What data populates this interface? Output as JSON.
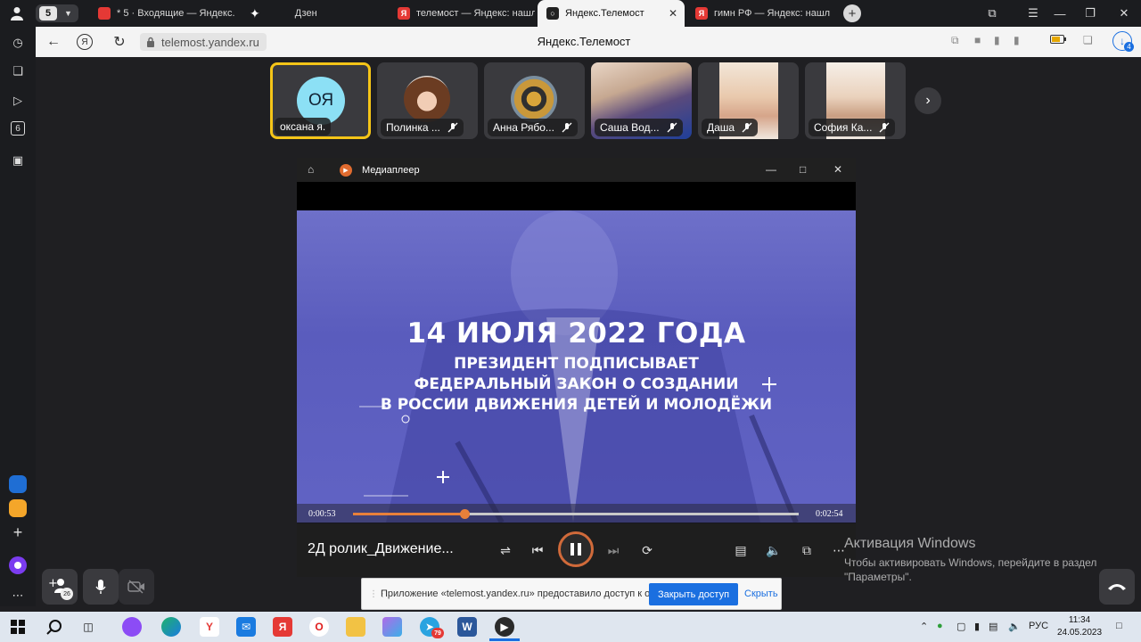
{
  "browser": {
    "tab_count": "5",
    "tabs": [
      {
        "label": "* 5 · Входящие — Яндекс.",
        "fav_color": "#e53935"
      },
      {
        "label": "Дзен",
        "fav_color": "#000000"
      },
      {
        "label": "телемост — Яндекс: нашл",
        "fav_color": "#e53935"
      },
      {
        "label": "Яндекс.Телемост",
        "fav_color": "#222222"
      },
      {
        "label": "гимн РФ — Яндекс: нашл",
        "fav_color": "#e53935"
      }
    ],
    "url": "telemost.yandex.ru",
    "page_title": "Яндекс.Телемост",
    "downloads_badge": "4"
  },
  "participants": [
    {
      "name": "оксана я.",
      "initials": "ОЯ",
      "type": "initials",
      "selected": true
    },
    {
      "name": "Полинка ...",
      "type": "photo",
      "mic_muted": true
    },
    {
      "name": "Анна Рябо...",
      "type": "photo",
      "mic_muted": true
    },
    {
      "name": "Саша Вод...",
      "type": "video",
      "mic_muted": true
    },
    {
      "name": "Даша",
      "type": "video",
      "mic_muted": true
    },
    {
      "name": "София Ка...",
      "type": "video",
      "mic_muted": true
    }
  ],
  "player": {
    "app_title": "Медиаплеер",
    "video_headline": "14 ИЮЛЯ 2022 ГОДА",
    "video_lines": [
      "ПРЕЗИДЕНТ ПОДПИСЫВАЕТ",
      "ФЕДЕРАЛЬНЫЙ ЗАКОН О СОЗДАНИИ",
      "В РОССИИ ДВИЖЕНИЯ ДЕТЕЙ И МОЛОДЁЖИ"
    ],
    "time_current": "0:00:53",
    "time_total": "0:02:54",
    "progress_fraction": 0.25,
    "media_title": "2Д ролик_Движение..."
  },
  "controls": {
    "invite_count": "26"
  },
  "share_notice": {
    "message": "Приложение «telemost.yandex.ru» предоставило доступ к окну.",
    "stop_label": "Закрыть доступ",
    "hide_label": "Скрыть"
  },
  "activation": {
    "heading": "Активация Windows",
    "line1": "Чтобы активировать Windows, перейдите в раздел",
    "line2": "\"Параметры\"."
  },
  "taskbar": {
    "telegram_badge": "79",
    "language": "РУС",
    "time": "11:34",
    "date": "24.05.2023"
  }
}
